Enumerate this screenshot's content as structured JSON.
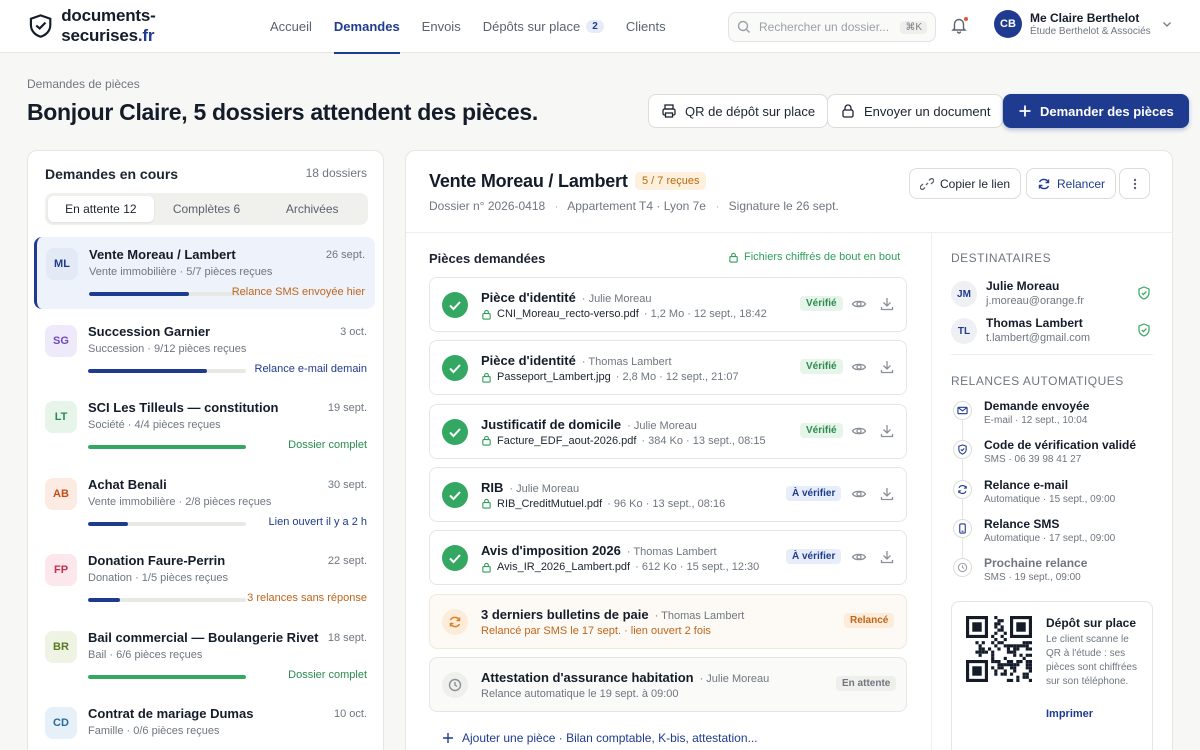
{
  "brand": {
    "name": "documents-securises",
    "tld": ".fr"
  },
  "nav": [
    {
      "label": "Accueil",
      "active": false
    },
    {
      "label": "Demandes",
      "active": true
    },
    {
      "label": "Envois",
      "active": false
    },
    {
      "label": "Dépôts sur place",
      "active": false,
      "badge": "2"
    },
    {
      "label": "Clients",
      "active": false
    }
  ],
  "search": {
    "placeholder": "Rechercher un dossier...",
    "shortcut": "⌘K"
  },
  "user": {
    "initials": "CB",
    "name": "Me Claire Berthelot",
    "firm": "Étude Berthelot & Associés"
  },
  "page": {
    "breadcrumb": "Demandes de pièces",
    "title": "Bonjour Claire, 5 dossiers attendent des pièces."
  },
  "actions": {
    "qr": "QR de dépôt sur place",
    "send": "Envoyer un document",
    "request": "Demander des pièces"
  },
  "left": {
    "title": "Demandes en cours",
    "count": "18 dossiers",
    "tabs": [
      {
        "label": "En attente",
        "count": "12",
        "on": true
      },
      {
        "label": "Complètes",
        "count": "6",
        "on": false
      },
      {
        "label": "Archivées",
        "count": "",
        "on": false
      }
    ],
    "rows": [
      {
        "initials": "ML",
        "name": "Vente Moreau / Lambert",
        "date": "26 sept.",
        "sub": "Vente immobilière · 5/7 pièces reçues",
        "progress": 0.63,
        "status": "Relance SMS envoyée hier",
        "tone": "orange",
        "avbg": "#e4e9f6",
        "avfg": "#1f3b8f",
        "sel": true
      },
      {
        "initials": "SG",
        "name": "Succession Garnier",
        "date": "3 oct.",
        "sub": "Succession · 9/12 pièces reçues",
        "progress": 0.75,
        "status": "Relance e-mail demain",
        "tone": "blue",
        "avbg": "#efeafa",
        "avfg": "#7048b8",
        "sel": false
      },
      {
        "initials": "LT",
        "name": "SCI Les Tilleuls — constitution",
        "date": "19 sept.",
        "sub": "Société · 4/4 pièces reçues",
        "progress": 1,
        "status": "Dossier complet",
        "tone": "green",
        "avbg": "#e6f4ea",
        "avfg": "#2a8c4f",
        "sel": false
      },
      {
        "initials": "AB",
        "name": "Achat Benali",
        "date": "30 sept.",
        "sub": "Vente immobilière · 2/8 pièces reçues",
        "progress": 0.25,
        "status": "Lien ouvert il y a 2 h",
        "tone": "blue",
        "avbg": "#fcebe3",
        "avfg": "#c0501a",
        "sel": false
      },
      {
        "initials": "FP",
        "name": "Donation Faure-Perrin",
        "date": "22 sept.",
        "sub": "Donation · 1/5 pièces reçues",
        "progress": 0.2,
        "status": "3 relances sans réponse",
        "tone": "orange",
        "avbg": "#fce8ec",
        "avfg": "#c03050",
        "sel": false
      },
      {
        "initials": "BR",
        "name": "Bail commercial — Boulangerie Rivet",
        "date": "18 sept.",
        "sub": "Bail · 6/6 pièces reçues",
        "progress": 1,
        "status": "Dossier complet",
        "tone": "green",
        "avbg": "#eef3e4",
        "avfg": "#5a7a22",
        "sel": false
      },
      {
        "initials": "CD",
        "name": "Contrat de mariage Dumas",
        "date": "10 oct.",
        "sub": "Famille · 0/6 pièces reçues",
        "progress": 0,
        "status": "",
        "tone": "blue",
        "avbg": "#e6f0f8",
        "avfg": "#2a6a9c",
        "sel": false
      }
    ]
  },
  "dossier": {
    "title": "Vente Moreau / Lambert",
    "badge": "5 / 7 reçues",
    "number": "Dossier n° 2026-0418",
    "property": "Appartement T4 · Lyon 7e",
    "signature": "Signature le 26 sept.",
    "copy": "Copier le lien",
    "relaunch": "Relancer",
    "pieces_title": "Pièces demandées",
    "encrypted": "Fichiers chiffrés de bout en bout",
    "items": [
      {
        "name": "Pièce d'identité",
        "who": "· Julie Moreau",
        "file": "CNI_Moreau_recto-verso.pdf",
        "meta": "· 1,2 Mo · 12 sept., 18:42",
        "tag": "Vérifié",
        "kind": "ok"
      },
      {
        "name": "Pièce d'identité",
        "who": "· Thomas Lambert",
        "file": "Passeport_Lambert.jpg",
        "meta": "· 2,8 Mo · 12 sept., 21:07",
        "tag": "Vérifié",
        "kind": "ok"
      },
      {
        "name": "Justificatif de domicile",
        "who": "· Julie Moreau",
        "file": "Facture_EDF_aout-2026.pdf",
        "meta": "· 384 Ko · 13 sept., 08:15",
        "tag": "Vérifié",
        "kind": "ok"
      },
      {
        "name": "RIB",
        "who": "· Julie Moreau",
        "file": "RIB_CreditMutuel.pdf",
        "meta": "· 96 Ko · 13 sept., 08:16",
        "tag": "À vérifier",
        "kind": "rv"
      },
      {
        "name": "Avis d'imposition 2026",
        "who": "· Thomas Lambert",
        "file": "Avis_IR_2026_Lambert.pdf",
        "meta": "· 612 Ko · 15 sept., 12:30",
        "tag": "À vérifier",
        "kind": "rv"
      },
      {
        "name": "3 derniers bulletins de paie",
        "who": "· Thomas Lambert",
        "note": "Relancé par SMS le 17 sept. · lien ouvert 2 fois",
        "tag": "Relancé",
        "kind": "rl"
      },
      {
        "name": "Attestation d'assurance habitation",
        "who": "· Julie Moreau",
        "note": "Relance automatique le 19 sept. à 09:00",
        "tag": "En attente",
        "kind": "wt"
      }
    ],
    "add": "Ajouter une pièce · Bilan comptable, K-bis, attestation..."
  },
  "side": {
    "recipients_title": "DESTINATAIRES",
    "recipients": [
      {
        "initials": "JM",
        "name": "Julie Moreau",
        "email": "j.moreau@orange.fr"
      },
      {
        "initials": "TL",
        "name": "Thomas Lambert",
        "email": "t.lambert@gmail.com"
      }
    ],
    "timeline_title": "RELANCES AUTOMATIQUES",
    "timeline": [
      {
        "icon": "mail",
        "title": "Demande envoyée",
        "meta": "E-mail · 12 sept., 10:04",
        "dim": false
      },
      {
        "icon": "shield",
        "title": "Code de vérification validé",
        "meta": "SMS · 06 39 98 41 27",
        "dim": false
      },
      {
        "icon": "refresh",
        "title": "Relance e-mail",
        "meta": "Automatique · 15 sept., 09:00",
        "dim": false
      },
      {
        "icon": "phone",
        "title": "Relance SMS",
        "meta": "Automatique · 17 sept., 09:00",
        "dim": false
      },
      {
        "icon": "clock",
        "title": "Prochaine relance",
        "meta": "SMS · 19 sept., 09:00",
        "dim": true
      }
    ],
    "qr": {
      "title": "Dépôt sur place",
      "text": "Le client scanne le QR à l'étude : ses pièces sont chiffrées sur son téléphone.",
      "print": "Imprimer"
    }
  }
}
